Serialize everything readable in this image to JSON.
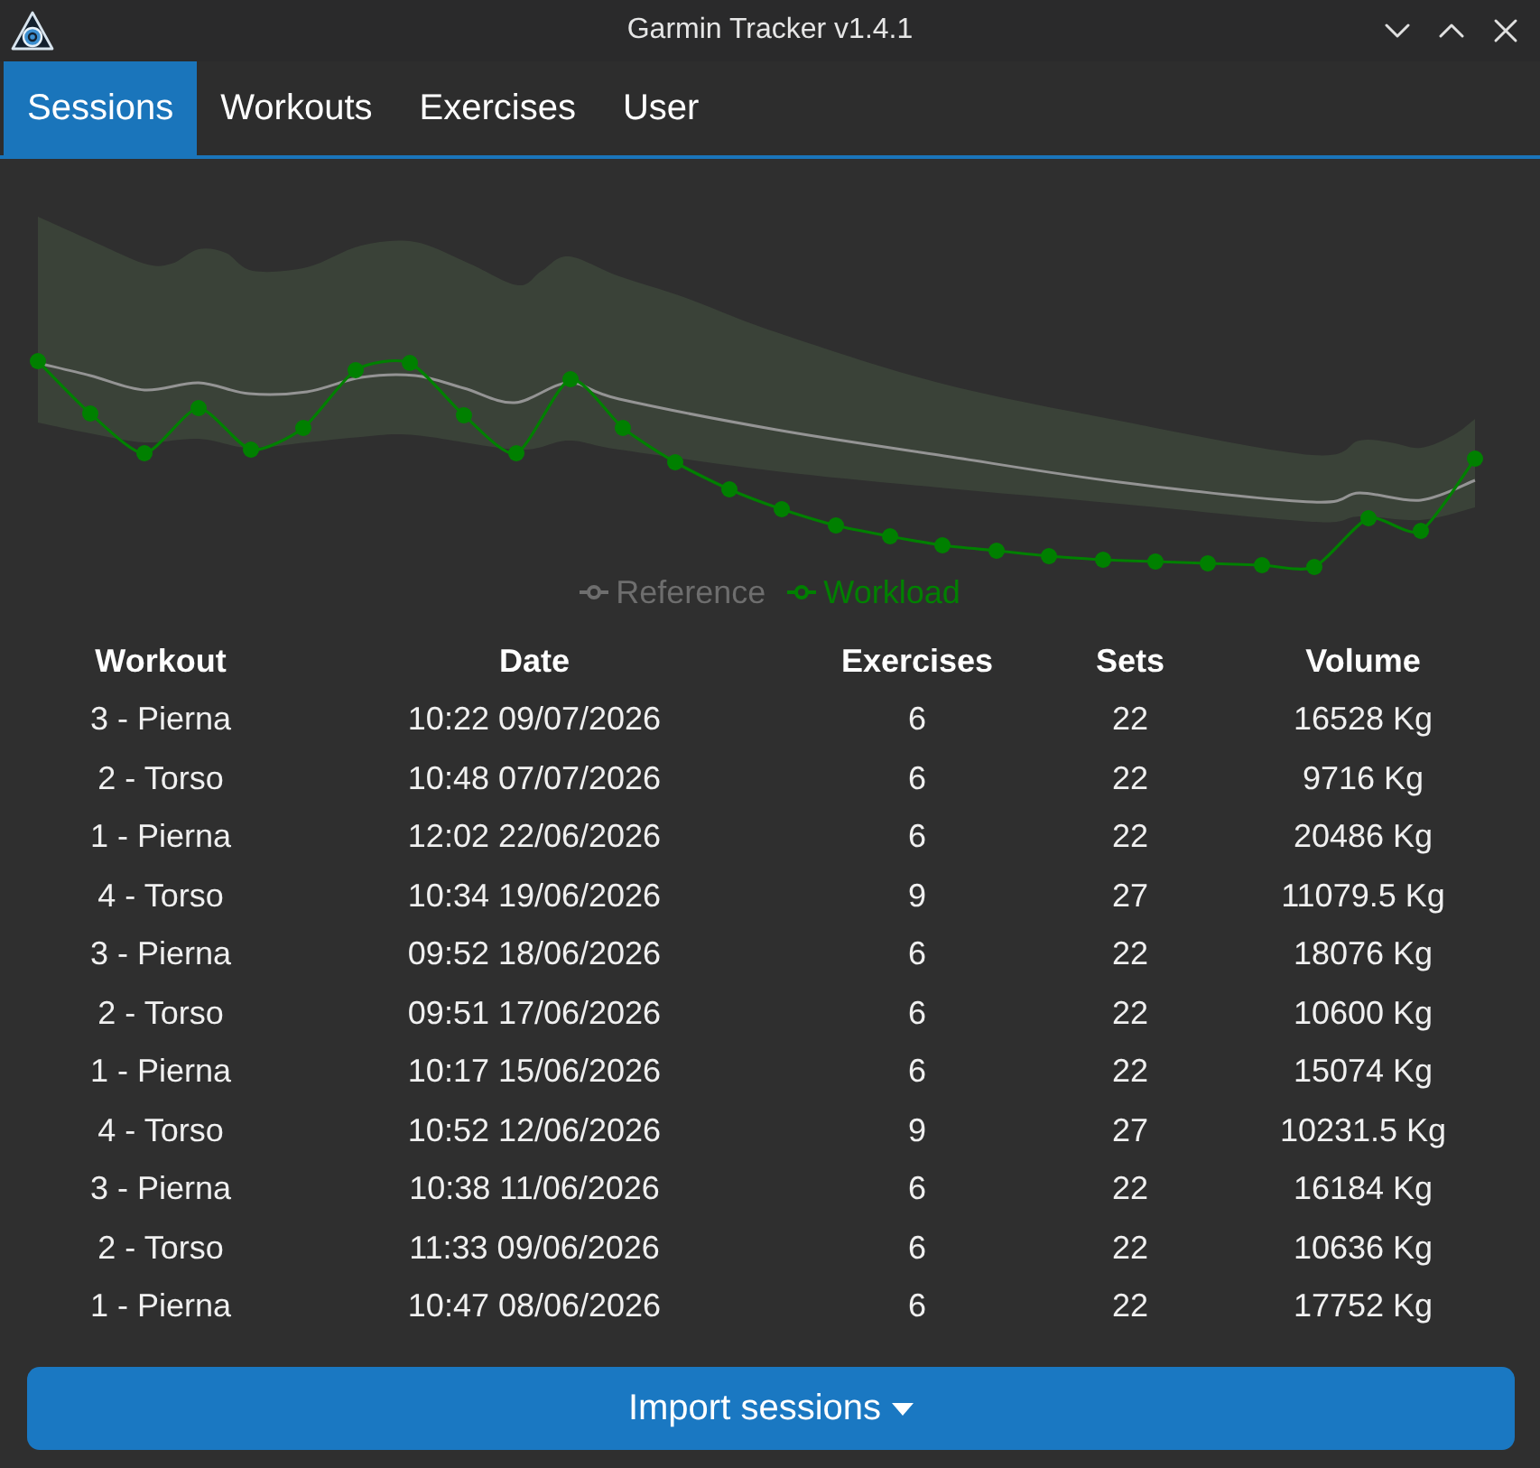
{
  "window": {
    "title": "Garmin Tracker v1.4.1"
  },
  "tabs": [
    {
      "label": "Sessions",
      "selected": true
    },
    {
      "label": "Workouts",
      "selected": false
    },
    {
      "label": "Exercises",
      "selected": false
    },
    {
      "label": "User",
      "selected": false
    }
  ],
  "chart": {
    "legend": [
      {
        "label": "Reference",
        "color": "#6e6e6e"
      },
      {
        "label": "Workload",
        "color": "#008000"
      }
    ]
  },
  "table": {
    "columns": [
      "Workout",
      "Date",
      "Exercises",
      "Sets",
      "Volume"
    ],
    "rows": [
      [
        "3 - Pierna",
        "10:22 09/07/2026",
        "6",
        "22",
        "16528 Kg"
      ],
      [
        "2 - Torso",
        "10:48 07/07/2026",
        "6",
        "22",
        "9716 Kg"
      ],
      [
        "1 - Pierna",
        "12:02 22/06/2026",
        "6",
        "22",
        "20486 Kg"
      ],
      [
        "4 - Torso",
        "10:34 19/06/2026",
        "9",
        "27",
        "11079.5 Kg"
      ],
      [
        "3 - Pierna",
        "09:52 18/06/2026",
        "6",
        "22",
        "18076 Kg"
      ],
      [
        "2 - Torso",
        "09:51 17/06/2026",
        "6",
        "22",
        "10600 Kg"
      ],
      [
        "1 - Pierna",
        "10:17 15/06/2026",
        "6",
        "22",
        "15074 Kg"
      ],
      [
        "4 - Torso",
        "10:52 12/06/2026",
        "9",
        "27",
        "10231.5 Kg"
      ],
      [
        "3 - Pierna",
        "10:38 11/06/2026",
        "6",
        "22",
        "16184 Kg"
      ],
      [
        "2 - Torso",
        "11:33 09/06/2026",
        "6",
        "22",
        "10636 Kg"
      ],
      [
        "1 - Pierna",
        "10:47 08/06/2026",
        "6",
        "22",
        "17752 Kg"
      ]
    ]
  },
  "import_button": {
    "label": "Import sessions"
  }
}
